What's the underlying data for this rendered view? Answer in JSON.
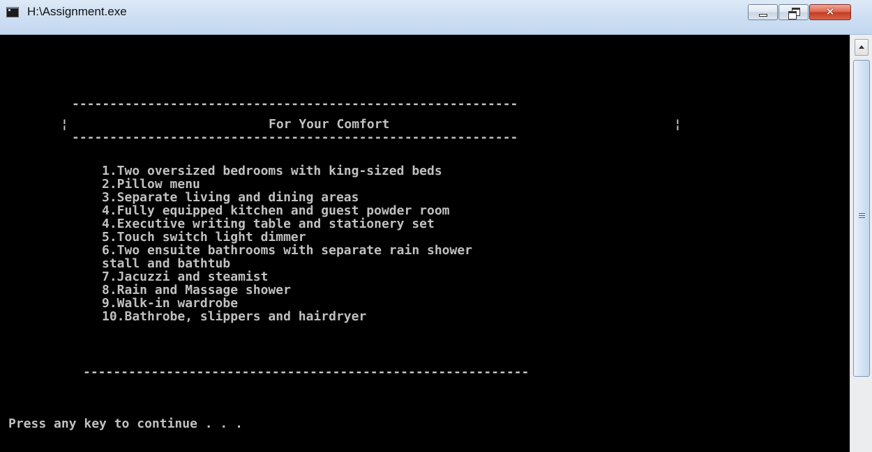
{
  "window": {
    "title": "H:\\Assignment.exe",
    "icon": "console-app-icon",
    "close_glyph": "✕"
  },
  "console": {
    "divider_top": "-----------------------------------------------------------",
    "box_left": "¦",
    "heading": "For Your Comfort",
    "box_right": "¦",
    "divider_mid": "-----------------------------------------------------------",
    "items": [
      "1.Two oversized bedrooms with king-sized beds",
      "2.Pillow menu",
      "3.Separate living and dining areas",
      "4.Fully equipped kitchen and guest powder room",
      "4.Executive writing table and stationery set",
      "5.Touch switch light dimmer",
      "6.Two ensuite bathrooms with separate rain shower",
      "stall and bathtub",
      "7.Jacuzzi and steamist",
      "8.Rain and Massage shower",
      "9.Walk-in wardrobe",
      "10.Bathrobe, slippers and hairdryer"
    ],
    "divider_bottom": "-----------------------------------------------------------",
    "prompt": "Press any key to continue . . ."
  },
  "colors": {
    "console_bg": "#000000",
    "console_text": "#c0c0c0",
    "titlebar": "#cfe0f3",
    "close_button": "#c23b22"
  }
}
